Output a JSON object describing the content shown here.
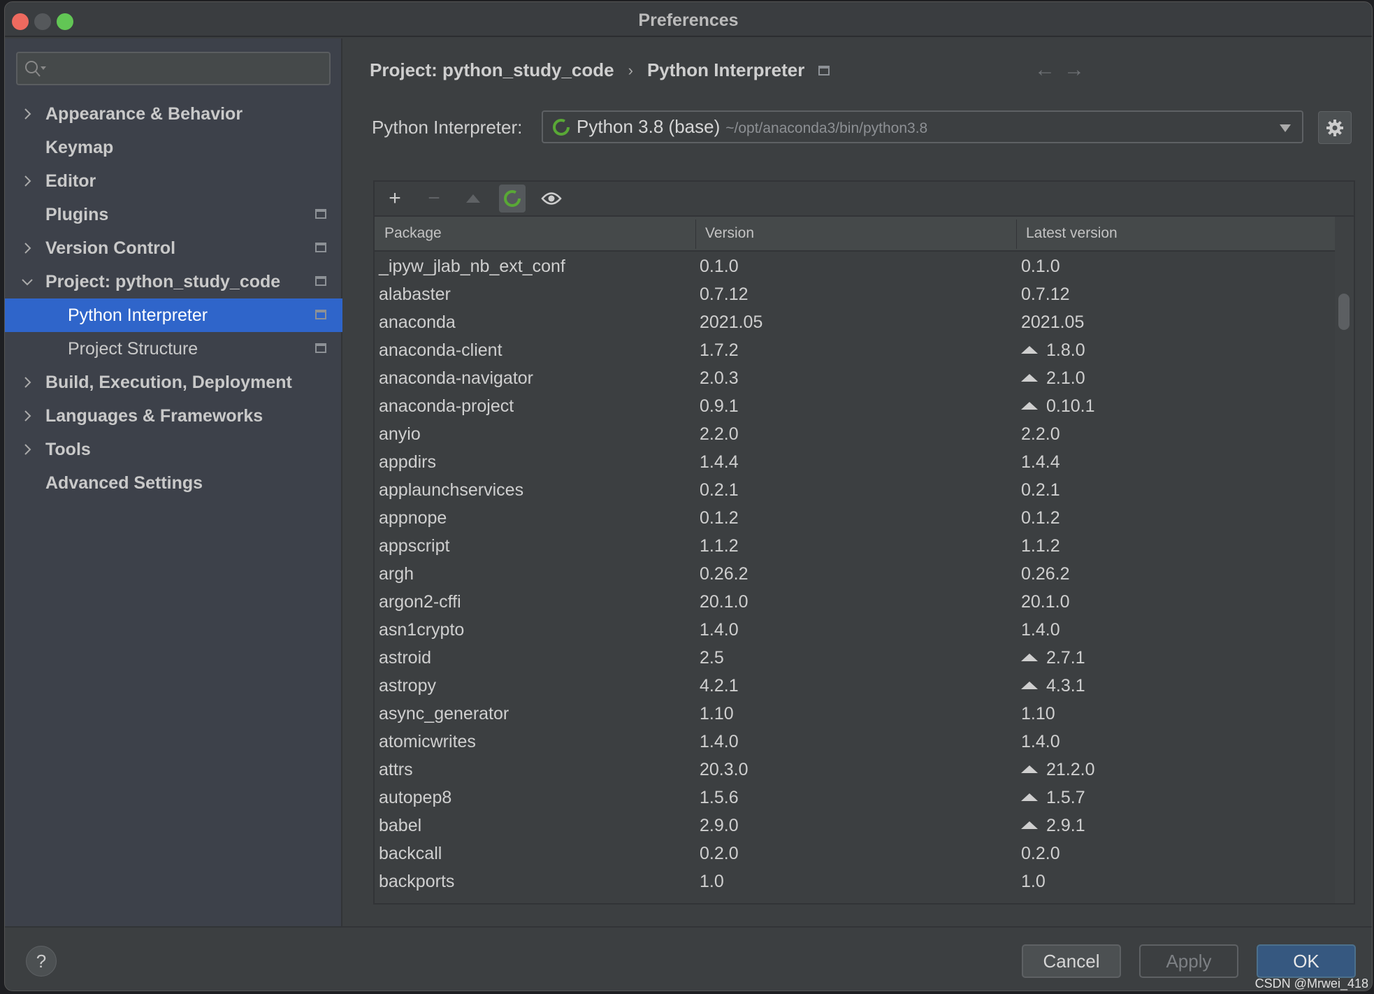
{
  "window": {
    "title": "Preferences"
  },
  "colors": {
    "accent": "#2f65ca",
    "ok_button": "#365880",
    "spinner": "#59a836",
    "close": "#ee6a5f",
    "minimize": "#55585b",
    "maximize": "#62c655"
  },
  "search": {
    "placeholder": ""
  },
  "sidebar": {
    "items": [
      {
        "label": "Appearance & Behavior",
        "expandable": true
      },
      {
        "label": "Keymap"
      },
      {
        "label": "Editor",
        "expandable": true
      },
      {
        "label": "Plugins",
        "project_icon": true
      },
      {
        "label": "Version Control",
        "expandable": true,
        "project_icon": true
      },
      {
        "label": "Project: python_study_code",
        "expanded": true,
        "project_icon": true
      },
      {
        "label": "Python Interpreter",
        "selected": true,
        "project_icon": true
      },
      {
        "label": "Project Structure",
        "project_icon": true
      },
      {
        "label": "Build, Execution, Deployment",
        "expandable": true
      },
      {
        "label": "Languages & Frameworks",
        "expandable": true
      },
      {
        "label": "Tools",
        "expandable": true
      },
      {
        "label": "Advanced Settings"
      }
    ]
  },
  "breadcrumb": {
    "project": "Project: python_study_code",
    "page": "Python Interpreter",
    "separator": "›"
  },
  "interpreter": {
    "label": "Python Interpreter:",
    "name": "Python 3.8 (base)",
    "path": "~/opt/anaconda3/bin/python3.8"
  },
  "toolbar": {
    "icons": [
      "plus-icon",
      "minus-icon",
      "upgrade-icon",
      "refresh-icon",
      "eye-icon"
    ]
  },
  "table": {
    "columns": [
      "Package",
      "Version",
      "Latest version"
    ],
    "rows": [
      [
        "_ipyw_jlab_nb_ext_conf",
        "0.1.0",
        "0.1.0",
        false
      ],
      [
        "alabaster",
        "0.7.12",
        "0.7.12",
        false
      ],
      [
        "anaconda",
        "2021.05",
        "2021.05",
        false
      ],
      [
        "anaconda-client",
        "1.7.2",
        "1.8.0",
        true
      ],
      [
        "anaconda-navigator",
        "2.0.3",
        "2.1.0",
        true
      ],
      [
        "anaconda-project",
        "0.9.1",
        "0.10.1",
        true
      ],
      [
        "anyio",
        "2.2.0",
        "2.2.0",
        false
      ],
      [
        "appdirs",
        "1.4.4",
        "1.4.4",
        false
      ],
      [
        "applaunchservices",
        "0.2.1",
        "0.2.1",
        false
      ],
      [
        "appnope",
        "0.1.2",
        "0.1.2",
        false
      ],
      [
        "appscript",
        "1.1.2",
        "1.1.2",
        false
      ],
      [
        "argh",
        "0.26.2",
        "0.26.2",
        false
      ],
      [
        "argon2-cffi",
        "20.1.0",
        "20.1.0",
        false
      ],
      [
        "asn1crypto",
        "1.4.0",
        "1.4.0",
        false
      ],
      [
        "astroid",
        "2.5",
        "2.7.1",
        true
      ],
      [
        "astropy",
        "4.2.1",
        "4.3.1",
        true
      ],
      [
        "async_generator",
        "1.10",
        "1.10",
        false
      ],
      [
        "atomicwrites",
        "1.4.0",
        "1.4.0",
        false
      ],
      [
        "attrs",
        "20.3.0",
        "21.2.0",
        true
      ],
      [
        "autopep8",
        "1.5.6",
        "1.5.7",
        true
      ],
      [
        "babel",
        "2.9.0",
        "2.9.1",
        true
      ],
      [
        "backcall",
        "0.2.0",
        "0.2.0",
        false
      ],
      [
        "backports",
        "1.0",
        "1.0",
        false
      ]
    ]
  },
  "footer": {
    "help": "?",
    "cancel": "Cancel",
    "apply": "Apply",
    "ok": "OK"
  },
  "watermark": "CSDN @Mrwei_418"
}
